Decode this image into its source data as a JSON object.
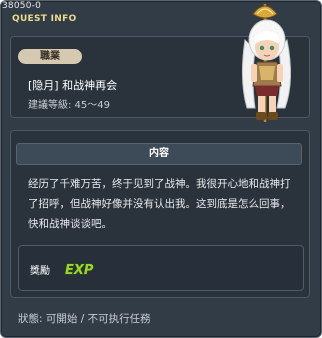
{
  "window": {
    "id": "38050-0",
    "title": "QUEST INFO"
  },
  "header": {
    "job_badge": "職業",
    "quest_name": "[隐月] 和战神再会",
    "level": "建議等級: 45～49"
  },
  "content": {
    "section_title": "内容",
    "description": "经历了千难万苦，终于见到了战神。我很开心地和战神打了招呼，但战神好像并没有认出我。这到底是怎么回事，快和战神谈谈吧。"
  },
  "reward": {
    "label": "獎勵",
    "exp_text": "EXP"
  },
  "status": {
    "text": "狀態: 可開始 / 不可执行任務"
  },
  "icons": [
    "npc-portrait",
    "exp-icon"
  ],
  "colors": {
    "background": "#323c47",
    "panel": "#2a323b",
    "title": "#e9dc8a",
    "badge": "#d6c9b2",
    "exp_green": "#9bd62a"
  }
}
